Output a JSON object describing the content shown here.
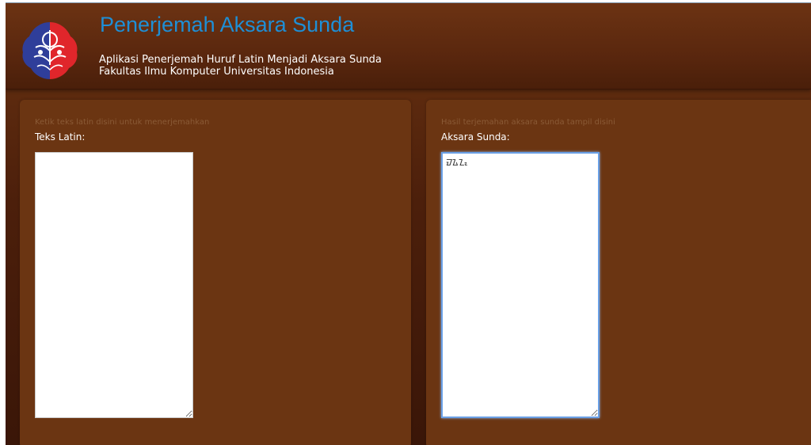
{
  "header": {
    "title": "Penerjemah Aksara Sunda",
    "subtitle_line1": "Aplikasi Penerjemah Huruf Latin Menjadi Aksara Sunda",
    "subtitle_line2": "Fakultas Ilmu Komputer Universitas Indonesia",
    "logo_icon": "university-emblem-icon",
    "colors": {
      "title": "#1e8fd6",
      "background": "#5a270e",
      "logo_blue": "#2f3e9a",
      "logo_red": "#e0262b"
    }
  },
  "left_panel": {
    "hint": "Ketik teks latin disini untuk menerjemahkan",
    "label": "Teks Latin:",
    "textarea_value": "",
    "resize_icon": "resize-grip-icon"
  },
  "right_panel": {
    "hint": "Hasil terjemahan aksara sunda tampil disini",
    "label": "Aksara Sunda:",
    "textarea_value": "ᮙᮍᮔᮧ",
    "resize_icon": "resize-grip-icon"
  }
}
